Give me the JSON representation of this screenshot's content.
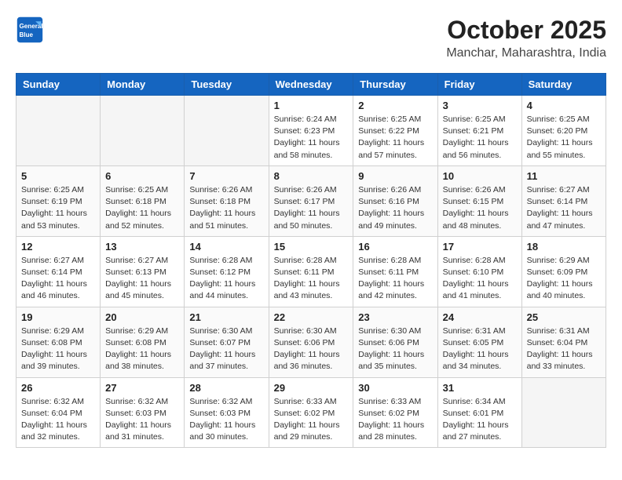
{
  "header": {
    "logo_line1": "General",
    "logo_line2": "Blue",
    "month": "October 2025",
    "location": "Manchar, Maharashtra, India"
  },
  "weekdays": [
    "Sunday",
    "Monday",
    "Tuesday",
    "Wednesday",
    "Thursday",
    "Friday",
    "Saturday"
  ],
  "weeks": [
    [
      {
        "day": "",
        "info": ""
      },
      {
        "day": "",
        "info": ""
      },
      {
        "day": "",
        "info": ""
      },
      {
        "day": "1",
        "info": "Sunrise: 6:24 AM\nSunset: 6:23 PM\nDaylight: 11 hours\nand 58 minutes."
      },
      {
        "day": "2",
        "info": "Sunrise: 6:25 AM\nSunset: 6:22 PM\nDaylight: 11 hours\nand 57 minutes."
      },
      {
        "day": "3",
        "info": "Sunrise: 6:25 AM\nSunset: 6:21 PM\nDaylight: 11 hours\nand 56 minutes."
      },
      {
        "day": "4",
        "info": "Sunrise: 6:25 AM\nSunset: 6:20 PM\nDaylight: 11 hours\nand 55 minutes."
      }
    ],
    [
      {
        "day": "5",
        "info": "Sunrise: 6:25 AM\nSunset: 6:19 PM\nDaylight: 11 hours\nand 53 minutes."
      },
      {
        "day": "6",
        "info": "Sunrise: 6:25 AM\nSunset: 6:18 PM\nDaylight: 11 hours\nand 52 minutes."
      },
      {
        "day": "7",
        "info": "Sunrise: 6:26 AM\nSunset: 6:18 PM\nDaylight: 11 hours\nand 51 minutes."
      },
      {
        "day": "8",
        "info": "Sunrise: 6:26 AM\nSunset: 6:17 PM\nDaylight: 11 hours\nand 50 minutes."
      },
      {
        "day": "9",
        "info": "Sunrise: 6:26 AM\nSunset: 6:16 PM\nDaylight: 11 hours\nand 49 minutes."
      },
      {
        "day": "10",
        "info": "Sunrise: 6:26 AM\nSunset: 6:15 PM\nDaylight: 11 hours\nand 48 minutes."
      },
      {
        "day": "11",
        "info": "Sunrise: 6:27 AM\nSunset: 6:14 PM\nDaylight: 11 hours\nand 47 minutes."
      }
    ],
    [
      {
        "day": "12",
        "info": "Sunrise: 6:27 AM\nSunset: 6:14 PM\nDaylight: 11 hours\nand 46 minutes."
      },
      {
        "day": "13",
        "info": "Sunrise: 6:27 AM\nSunset: 6:13 PM\nDaylight: 11 hours\nand 45 minutes."
      },
      {
        "day": "14",
        "info": "Sunrise: 6:28 AM\nSunset: 6:12 PM\nDaylight: 11 hours\nand 44 minutes."
      },
      {
        "day": "15",
        "info": "Sunrise: 6:28 AM\nSunset: 6:11 PM\nDaylight: 11 hours\nand 43 minutes."
      },
      {
        "day": "16",
        "info": "Sunrise: 6:28 AM\nSunset: 6:11 PM\nDaylight: 11 hours\nand 42 minutes."
      },
      {
        "day": "17",
        "info": "Sunrise: 6:28 AM\nSunset: 6:10 PM\nDaylight: 11 hours\nand 41 minutes."
      },
      {
        "day": "18",
        "info": "Sunrise: 6:29 AM\nSunset: 6:09 PM\nDaylight: 11 hours\nand 40 minutes."
      }
    ],
    [
      {
        "day": "19",
        "info": "Sunrise: 6:29 AM\nSunset: 6:08 PM\nDaylight: 11 hours\nand 39 minutes."
      },
      {
        "day": "20",
        "info": "Sunrise: 6:29 AM\nSunset: 6:08 PM\nDaylight: 11 hours\nand 38 minutes."
      },
      {
        "day": "21",
        "info": "Sunrise: 6:30 AM\nSunset: 6:07 PM\nDaylight: 11 hours\nand 37 minutes."
      },
      {
        "day": "22",
        "info": "Sunrise: 6:30 AM\nSunset: 6:06 PM\nDaylight: 11 hours\nand 36 minutes."
      },
      {
        "day": "23",
        "info": "Sunrise: 6:30 AM\nSunset: 6:06 PM\nDaylight: 11 hours\nand 35 minutes."
      },
      {
        "day": "24",
        "info": "Sunrise: 6:31 AM\nSunset: 6:05 PM\nDaylight: 11 hours\nand 34 minutes."
      },
      {
        "day": "25",
        "info": "Sunrise: 6:31 AM\nSunset: 6:04 PM\nDaylight: 11 hours\nand 33 minutes."
      }
    ],
    [
      {
        "day": "26",
        "info": "Sunrise: 6:32 AM\nSunset: 6:04 PM\nDaylight: 11 hours\nand 32 minutes."
      },
      {
        "day": "27",
        "info": "Sunrise: 6:32 AM\nSunset: 6:03 PM\nDaylight: 11 hours\nand 31 minutes."
      },
      {
        "day": "28",
        "info": "Sunrise: 6:32 AM\nSunset: 6:03 PM\nDaylight: 11 hours\nand 30 minutes."
      },
      {
        "day": "29",
        "info": "Sunrise: 6:33 AM\nSunset: 6:02 PM\nDaylight: 11 hours\nand 29 minutes."
      },
      {
        "day": "30",
        "info": "Sunrise: 6:33 AM\nSunset: 6:02 PM\nDaylight: 11 hours\nand 28 minutes."
      },
      {
        "day": "31",
        "info": "Sunrise: 6:34 AM\nSunset: 6:01 PM\nDaylight: 11 hours\nand 27 minutes."
      },
      {
        "day": "",
        "info": ""
      }
    ]
  ]
}
